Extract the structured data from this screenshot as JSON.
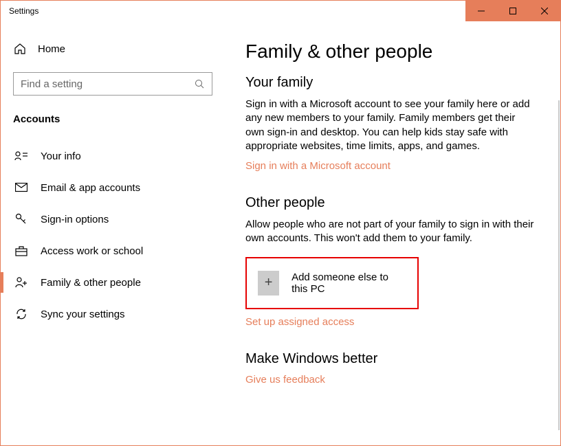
{
  "window": {
    "title": "Settings"
  },
  "sidebar": {
    "home": "Home",
    "search_placeholder": "Find a setting",
    "category": "Accounts",
    "items": [
      {
        "label": "Your info"
      },
      {
        "label": "Email & app accounts"
      },
      {
        "label": "Sign-in options"
      },
      {
        "label": "Access work or school"
      },
      {
        "label": "Family & other people"
      },
      {
        "label": "Sync your settings"
      }
    ]
  },
  "main": {
    "title": "Family & other people",
    "family": {
      "heading": "Your family",
      "desc": "Sign in with a Microsoft account to see your family here or add any new members to your family. Family members get their own sign-in and desktop. You can help kids stay safe with appropriate websites, time limits, apps, and games.",
      "signin_link": "Sign in with a Microsoft account"
    },
    "other": {
      "heading": "Other people",
      "desc": "Allow people who are not part of your family to sign in with their own accounts. This won't add them to your family.",
      "add_label": "Add someone else to this PC",
      "assigned_link": "Set up assigned access"
    },
    "better": {
      "heading": "Make Windows better",
      "feedback_link": "Give us feedback"
    }
  }
}
